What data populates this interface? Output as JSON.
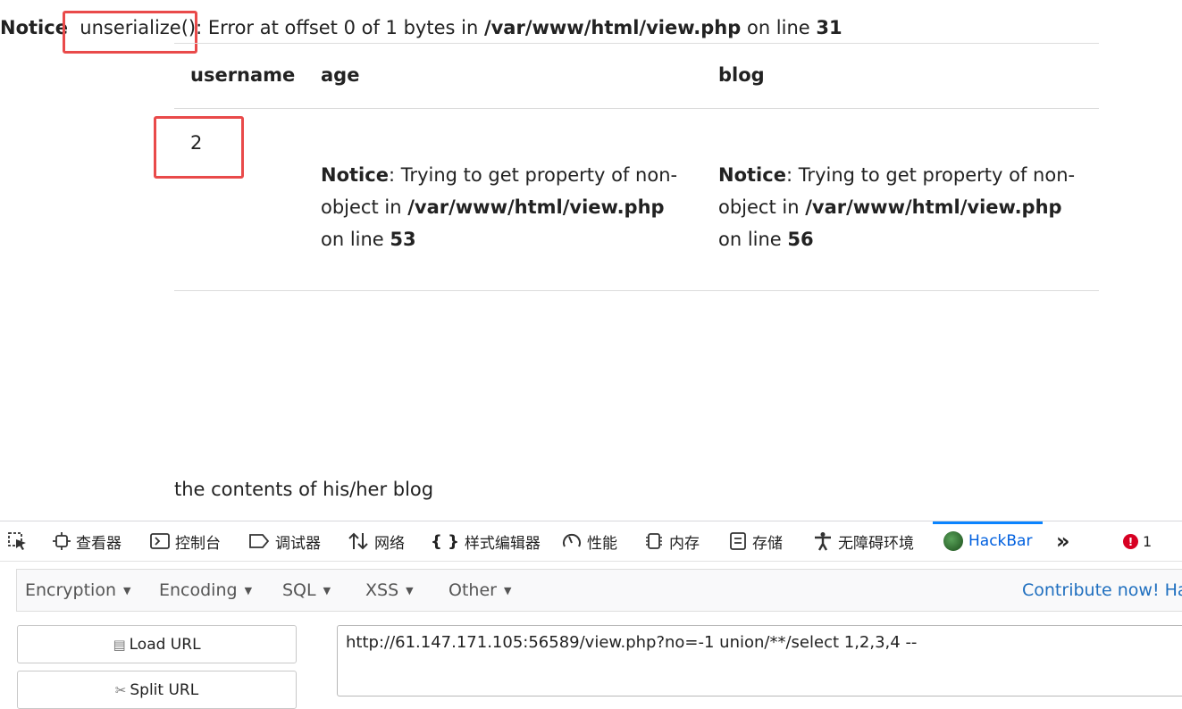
{
  "page": {
    "notice": {
      "label": "Notice",
      "func": "unserialize():",
      "msg": " Error at offset 0 of 1 bytes in ",
      "file": "/var/www/html/view.php",
      "online": " on line ",
      "line": "31"
    },
    "table": {
      "headers": [
        "username",
        "age",
        "blog"
      ],
      "row": {
        "username": "2",
        "age": {
          "label": "Notice",
          "msg1": ": Trying to get property of non-",
          "msg2": "object in ",
          "file": "/var/www/html/view.php",
          "online": "on line ",
          "line": "53"
        },
        "blog": {
          "label": "Notice",
          "msg1": ": Trying to get property of non-",
          "msg2": "object in ",
          "file": "/var/www/html/view.php",
          "online": "on line ",
          "line": "56"
        }
      }
    },
    "blog_contents": "the contents of his/her blog"
  },
  "devtools": {
    "tabs": [
      {
        "label": "",
        "icon": "inspector-pick-icon"
      },
      {
        "label": "查看器",
        "icon": "inspector-icon"
      },
      {
        "label": "控制台",
        "icon": "console-icon"
      },
      {
        "label": "调试器",
        "icon": "debugger-icon"
      },
      {
        "label": "网络",
        "icon": "network-icon"
      },
      {
        "label": "样式编辑器",
        "icon": "style-editor-icon"
      },
      {
        "label": "性能",
        "icon": "performance-icon"
      },
      {
        "label": "内存",
        "icon": "memory-icon"
      },
      {
        "label": "存储",
        "icon": "storage-icon"
      },
      {
        "label": "无障碍环境",
        "icon": "accessibility-icon"
      },
      {
        "label": "HackBar",
        "icon": "hackbar-icon"
      }
    ],
    "error_count": "1",
    "hackbar": {
      "menu": [
        "Encryption",
        "Encoding",
        "SQL",
        "XSS",
        "Other"
      ],
      "contribute": "Contribute now! Ha",
      "load_url": "Load URL",
      "split_url": "Split URL",
      "url": "http://61.147.171.105:56589/view.php?no=-1 union/**/select 1,2,3,4  --"
    }
  }
}
